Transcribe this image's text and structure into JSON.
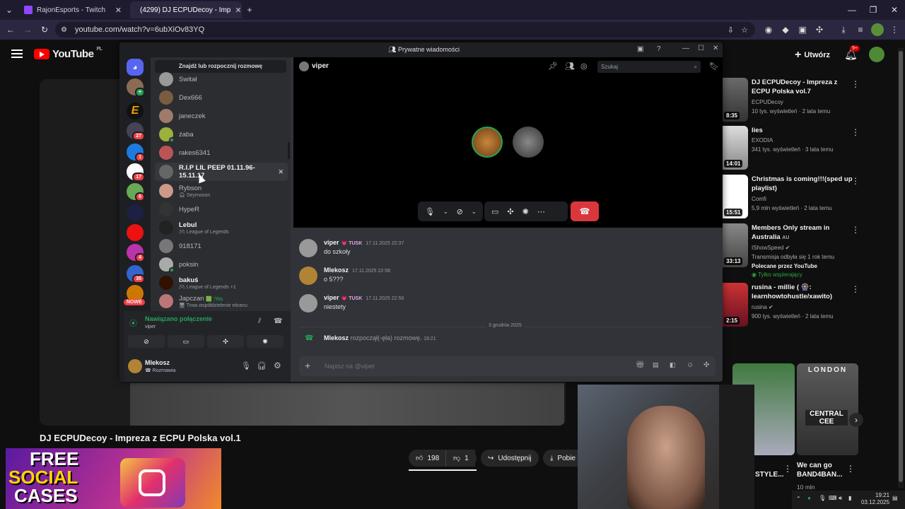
{
  "browser": {
    "tabs": [
      {
        "label": "RajonEsports - Twitch",
        "active": false
      },
      {
        "label": "(4299) DJ ECPUDecoy - Imp",
        "active": true
      }
    ],
    "url": "youtube.com/watch?v=6ubXiOv83YQ"
  },
  "youtube": {
    "logo_text": "YouTube",
    "region": "PL",
    "create_label": "Utwórz",
    "notif_count": "9+",
    "video_title": "DJ ECPUDecoy - Impreza z ECPU Polska vol.1",
    "likes": "198",
    "dislikes": "1",
    "share_label": "Udostępnij",
    "download_label": "Pobie",
    "recommendations": [
      {
        "title": "DJ ECPUDecoy - Impreza z ECPU Polska vol.7",
        "channel": "ECPUDecoy",
        "stats": "10 tys. wyświetleń · 2 lata temu",
        "duration": "8:35"
      },
      {
        "title": "lies",
        "channel": "EXODIA",
        "stats": "341 tys. wyświetleń · 3 lata temu",
        "duration": "14:01"
      },
      {
        "title": "Christmas is coming!!!(sped up playlist)",
        "channel": "Comfi",
        "stats": "5,9 mln wyświetleń · 2 lata temu",
        "duration": "15:51"
      },
      {
        "title": "Members Only stream in Australia",
        "title_suffix": "AU",
        "channel": "IShowSpeed",
        "stats": "Transmisja odbyła się 1 rok temu",
        "extra": "Polecane przez YouTube",
        "extra2": "Tylko wspierający",
        "duration": "33:13"
      },
      {
        "title": "rusina - millie ( 🎡: learnhowtohustle/xawito)",
        "channel": "rusina",
        "stats": "900 tys. wyświetleń · 2 lata temu",
        "duration": "2:15"
      }
    ],
    "shorts": [
      {
        "title": "STYLE..."
      },
      {
        "title": "We can go BAND4BAN...",
        "stats": "10 mln"
      }
    ],
    "shorts_thumb_text": "LONDON",
    "shorts_thumb_text2": "CENTRAL CEE"
  },
  "discord": {
    "window_title": "Prywatne wiadomości",
    "search_dm_label": "Znajdź lub rozpocznij rozmowę",
    "channel_name": "viper",
    "search_placeholder": "Szukaj",
    "new_label": "NOWE",
    "server_badges": [
      "27",
      "1",
      "17",
      "6",
      "4",
      "35"
    ],
    "dms": [
      {
        "name": "Switał"
      },
      {
        "name": "Dex666"
      },
      {
        "name": "janeczek"
      },
      {
        "name": "żaba"
      },
      {
        "name": "rakes6341"
      },
      {
        "name": "R.I.P LIL PEEP 01.11.96-15.11.17"
      },
      {
        "name": "Rybson",
        "sub": "Seymooon"
      },
      {
        "name": "HypeR"
      },
      {
        "name": "Lebul",
        "sub": "League of Legends"
      },
      {
        "name": "918171"
      },
      {
        "name": "poksin"
      },
      {
        "name": "bakuś",
        "sub": "League of Legends +1"
      },
      {
        "name": "Japczan",
        "sub": "Trwa współdzielenie ekranu",
        "tag": "78iq"
      }
    ],
    "voice_status": "Nawiązano połączenie",
    "voice_channel": "viper",
    "user_name": "Mlekosz",
    "user_status": "Rozmawia",
    "messages": [
      {
        "author": "viper",
        "tag": "TUSK",
        "time": "17.11.2025 22:37",
        "text": "do szkoły"
      },
      {
        "author": "Mlekosz",
        "tag": "",
        "time": "17.11.2025 22:58",
        "text": "o 5???"
      },
      {
        "author": "viper",
        "tag": "TUSK",
        "time": "17.11.2025 22:58",
        "text": "niestety"
      }
    ],
    "date_divider": "3 grudnia 2025",
    "call_event": {
      "author": "Mlekosz",
      "text": "rozpoczął(-ęła) rozmowę.",
      "time": "19:21"
    },
    "composer_placeholder": "Napisz na @viper"
  },
  "promo": {
    "line1": "FREE",
    "line2": "SOCIAL",
    "line3": "CASES"
  },
  "tray": {
    "time": "19:21",
    "date": "03.12.2025"
  },
  "colors": {
    "discord_blurple": "#5865f2",
    "hangup_red": "#da373c",
    "youtube_red": "#ff0000",
    "online_green": "#23a55a"
  }
}
